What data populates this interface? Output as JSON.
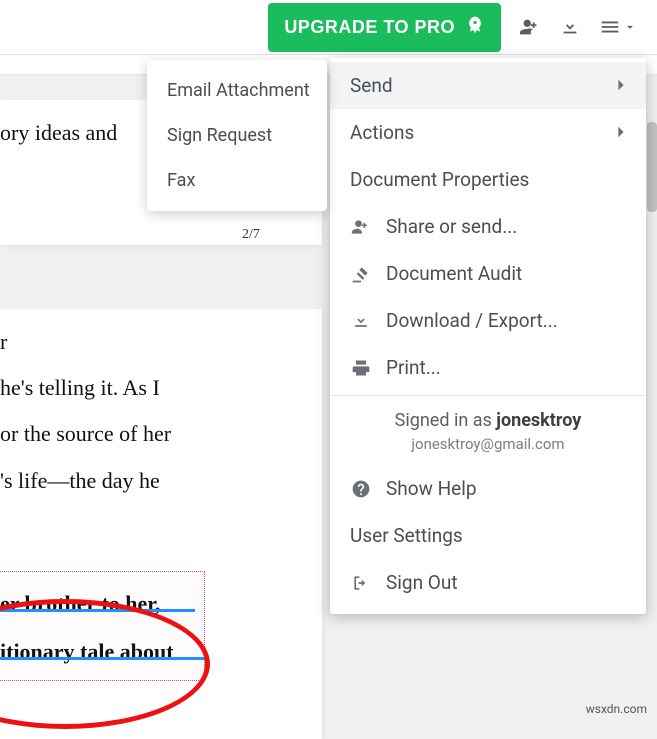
{
  "toolbar": {
    "upgrade_label": "UPGRADE TO PRO"
  },
  "submenu": {
    "items": [
      {
        "label": "Email Attachment"
      },
      {
        "label": "Sign Request"
      },
      {
        "label": "Fax"
      }
    ]
  },
  "dropdown": {
    "send": "Send",
    "actions": "Actions",
    "doc_props": "Document Properties",
    "share": "Share or send...",
    "audit": "Document Audit",
    "download": "Download / Export...",
    "print": "Print...",
    "signed_prefix": "Signed in as ",
    "signed_user": "jonesktroy",
    "signed_email": "jonesktroy@gmail.com",
    "help": "Show Help",
    "settings": "User Settings",
    "signout": "Sign Out"
  },
  "doc": {
    "page1_line1": "ory ideas and",
    "page1_num": "2/7",
    "page2_line1": "r",
    "page2_line2": "he's telling it. As I",
    "page2_line3": "or the source of her",
    "page2_line4": "'s life—the day he",
    "annot_line1": "er brother to her,",
    "annot_line2": "itionary tale about"
  },
  "watermark": "wsxdn.com"
}
